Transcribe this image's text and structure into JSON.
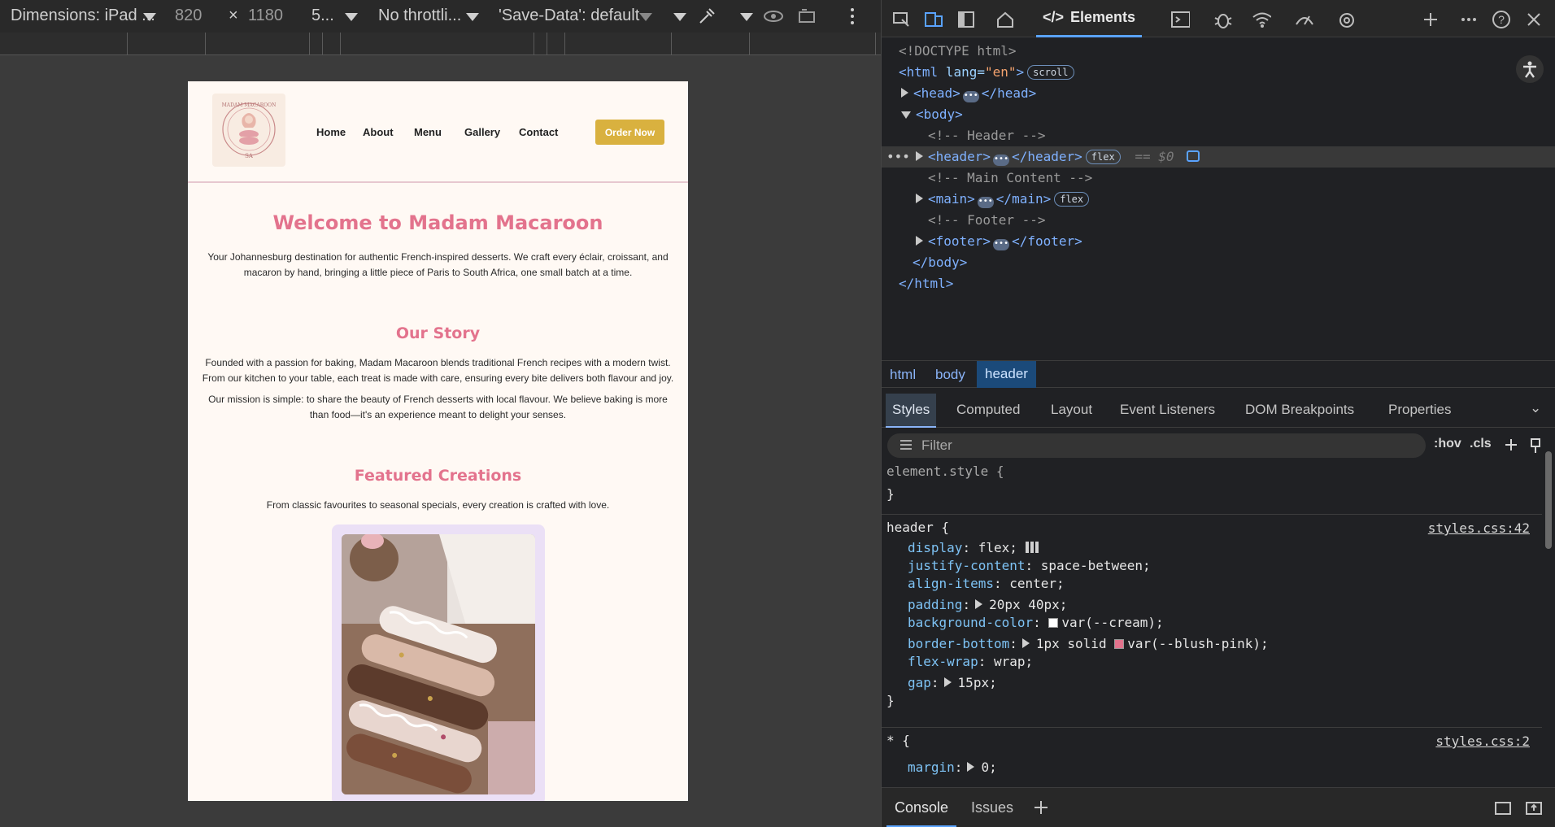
{
  "device_toolbar": {
    "dimensions_label": "Dimensions: iPad ...",
    "width": "820",
    "times": "×",
    "height": "1180",
    "zoom": "5...",
    "throttling": "No throttli...",
    "save_data": "'Save-Data': default"
  },
  "site": {
    "logo_text_top": "MADAM MACAROON",
    "logo_text_bottom": "SA",
    "nav": [
      "Home",
      "About",
      "Menu",
      "Gallery",
      "Contact"
    ],
    "order_button": "Order Now",
    "welcome_title": "Welcome to Madam Macaroon",
    "welcome_text": "Your Johannesburg destination for authentic French-inspired desserts. We craft every éclair, croissant, and macaron by hand, bringing a little piece of Paris to South Africa, one small batch at a time.",
    "story_title": "Our Story",
    "story_text_1": "Founded with a passion for baking, Madam Macaroon blends traditional French recipes with a modern twist. From our kitchen to your table, each treat is made with care, ensuring every bite delivers both flavour and joy.",
    "story_text_2": "Our mission is simple: to share the beauty of French desserts with local flavour. We believe baking is more than food—it's an experience meant to delight your senses.",
    "featured_title": "Featured Creations",
    "featured_text": "From classic favourites to seasonal specials, every creation is crafted with love."
  },
  "devtools": {
    "main_tab": "Elements",
    "dom": {
      "doctype": "<!DOCTYPE html>",
      "html_open_tag": "<html",
      "html_attr": " lang=",
      "html_lang": "\"en\"",
      "html_close_bracket": ">",
      "scroll_badge": "scroll",
      "head_open": "<head>",
      "head_close": "</head>",
      "body_open": "<body>",
      "comment_header": "<!-- Header -->",
      "header_open": "<header>",
      "header_close": "</header>",
      "flex_badge": "flex",
      "selected_marker": "== $0",
      "comment_main": "<!-- Main Content -->",
      "main_open": "<main>",
      "main_close": "</main>",
      "comment_footer": "<!-- Footer -->",
      "footer_open": "<footer>",
      "footer_close": "</footer>",
      "body_close": "</body>",
      "html_close": "</html>",
      "ellipsis": "•••"
    },
    "breadcrumbs": [
      "html",
      "body",
      "header"
    ],
    "subtabs": [
      "Styles",
      "Computed",
      "Layout",
      "Event Listeners",
      "DOM Breakpoints",
      "Properties"
    ],
    "filter_placeholder": "Filter",
    "hov": ":hov",
    "cls": ".cls",
    "styles": {
      "element_style": "element.style {",
      "close_brace": "}",
      "header_selector": "header {",
      "header_source": "styles.css:42",
      "rules": [
        {
          "prop": "display",
          "value": "flex;"
        },
        {
          "prop": "justify-content",
          "value": "space-between;"
        },
        {
          "prop": "align-items",
          "value": "center;"
        },
        {
          "prop": "padding",
          "value": "20px 40px;"
        },
        {
          "prop": "background-color",
          "value": "var(--cream);"
        },
        {
          "prop": "border-bottom",
          "value": "1px solid var(--blush-pink);"
        },
        {
          "prop": "flex-wrap",
          "value": "wrap;"
        },
        {
          "prop": "gap",
          "value": "15px;"
        }
      ],
      "universal_selector": "* {",
      "universal_source": "styles.css:2",
      "margin_prop": "margin",
      "margin_value": "0;"
    },
    "drawer_tabs": [
      "Console",
      "Issues"
    ],
    "colors": {
      "cream_swatch": "#ffffff",
      "blush_swatch": "#e3738d",
      "accent": "#5aa3ff"
    }
  }
}
